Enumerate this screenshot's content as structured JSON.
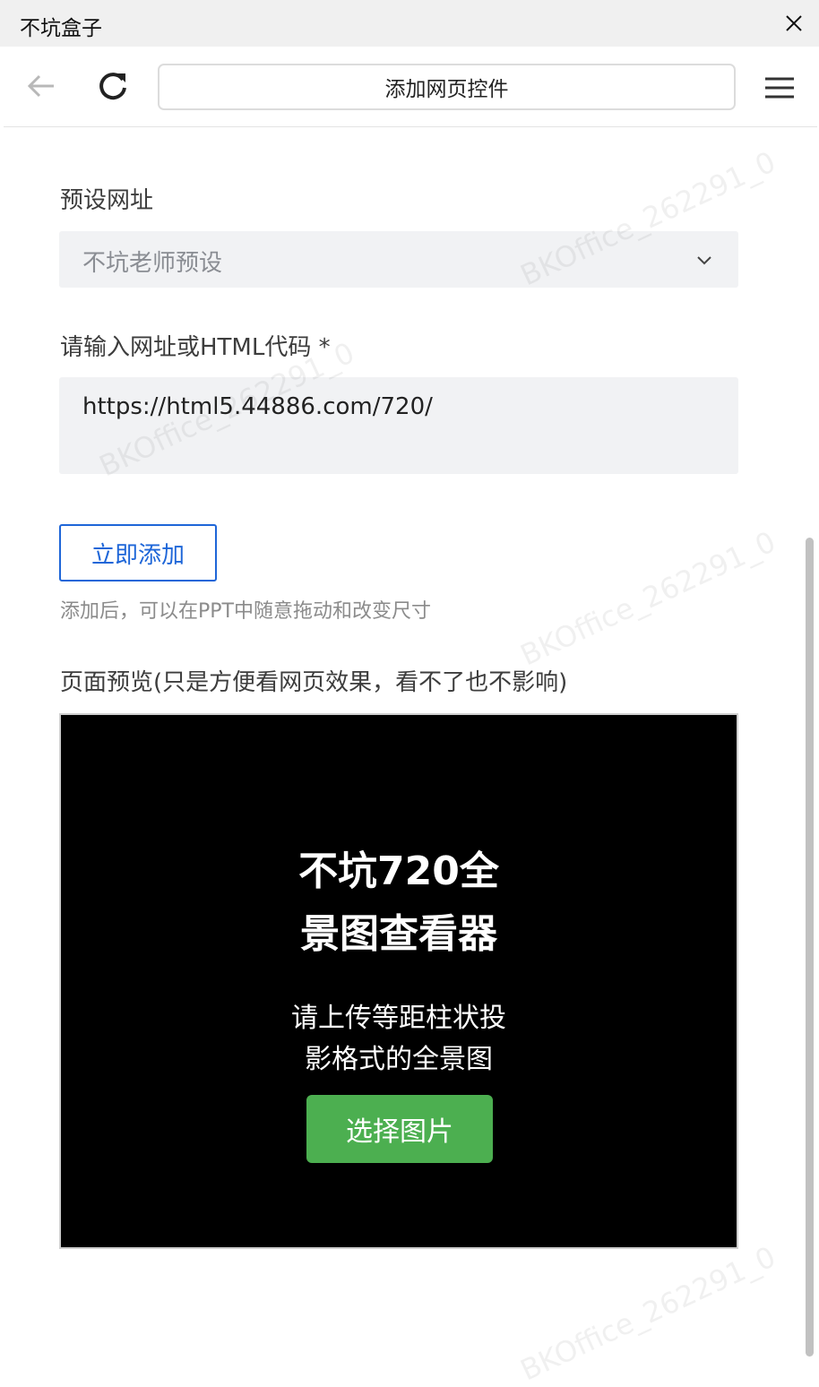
{
  "window": {
    "title": "不坑盒子"
  },
  "toolbar": {
    "address_title": "添加网页控件"
  },
  "form": {
    "preset_label": "预设网址",
    "preset_value": "不坑老师预设",
    "url_label": "请输入网址或HTML代码 *",
    "url_value": "https://html5.44886.com/720/",
    "add_button": "立即添加",
    "hint": "添加后，可以在PPT中随意拖动和改变尺寸",
    "preview_label": "页面预览(只是方便看网页效果，看不了也不影响)"
  },
  "preview": {
    "title_line1": "不坑720全",
    "title_line2": "景图查看器",
    "sub_line1": "请上传等距柱状投",
    "sub_line2": "影格式的全景图",
    "button": "选择图片"
  },
  "watermark": "BKOffice_262291_0",
  "colors": {
    "accent": "#1e66d8",
    "preview_button": "#4caf50",
    "field_bg": "#f1f2f4"
  },
  "icons": [
    "close-icon",
    "back-arrow-icon",
    "reload-icon",
    "hamburger-menu-icon",
    "chevron-down-icon"
  ]
}
